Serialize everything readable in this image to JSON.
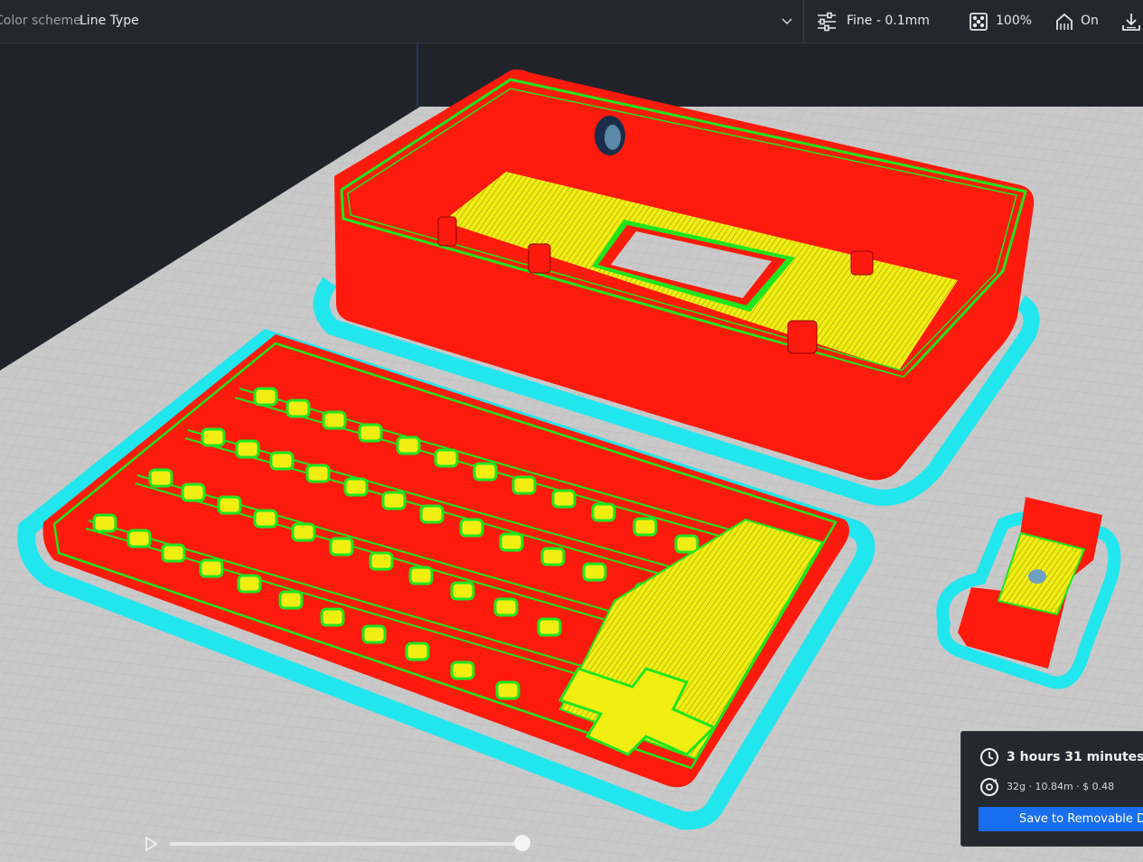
{
  "header": {
    "color_scheme_label": "Color scheme",
    "color_scheme_value": "Line Type",
    "quality": "Fine - 0.1mm",
    "infill": "100%",
    "support": "On"
  },
  "estimate": {
    "time": "3 hours 31 minutes",
    "material": "32g · 10.84m · $ 0.48",
    "save_label": "Save to Removable Drive"
  },
  "simulation": {
    "progress": 1.0
  },
  "colors": {
    "wall": "#ff1a0d",
    "inner_wall": "#1fe51f",
    "infill": "#f2ee12",
    "skirt": "#22e6ee",
    "accent": "#196ef0"
  }
}
